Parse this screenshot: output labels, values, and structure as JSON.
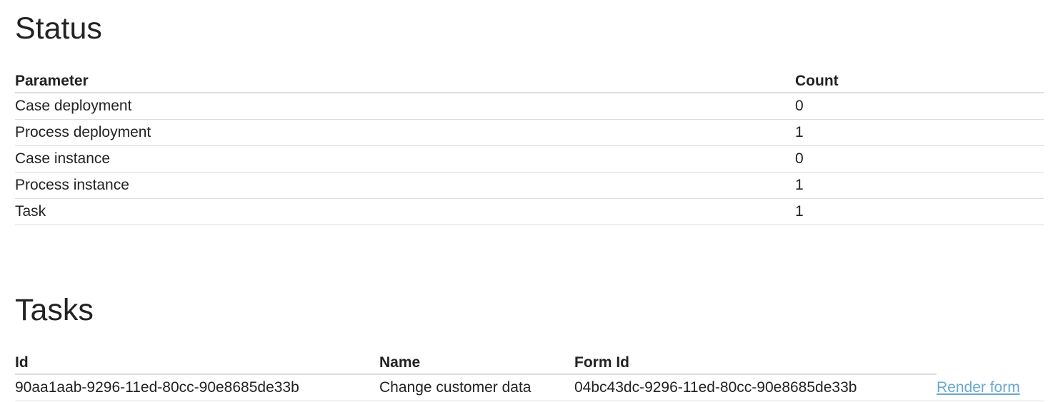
{
  "status": {
    "heading": "Status",
    "columns": {
      "parameter": "Parameter",
      "count": "Count"
    },
    "rows": [
      {
        "parameter": "Case deployment",
        "count": "0"
      },
      {
        "parameter": "Process deployment",
        "count": "1"
      },
      {
        "parameter": "Case instance",
        "count": "0"
      },
      {
        "parameter": "Process instance",
        "count": "1"
      },
      {
        "parameter": "Task",
        "count": "1"
      }
    ]
  },
  "tasks": {
    "heading": "Tasks",
    "columns": {
      "id": "Id",
      "name": "Name",
      "form_id": "Form Id"
    },
    "rows": [
      {
        "id": "90aa1aab-9296-11ed-80cc-90e8685de33b",
        "name": "Change customer data",
        "form_id": "04bc43dc-9296-11ed-80cc-90e8685de33b",
        "action_label": "Render form"
      }
    ]
  },
  "colors": {
    "text": "#222222",
    "link": "#6aa8cf",
    "border": "#dddddd"
  }
}
